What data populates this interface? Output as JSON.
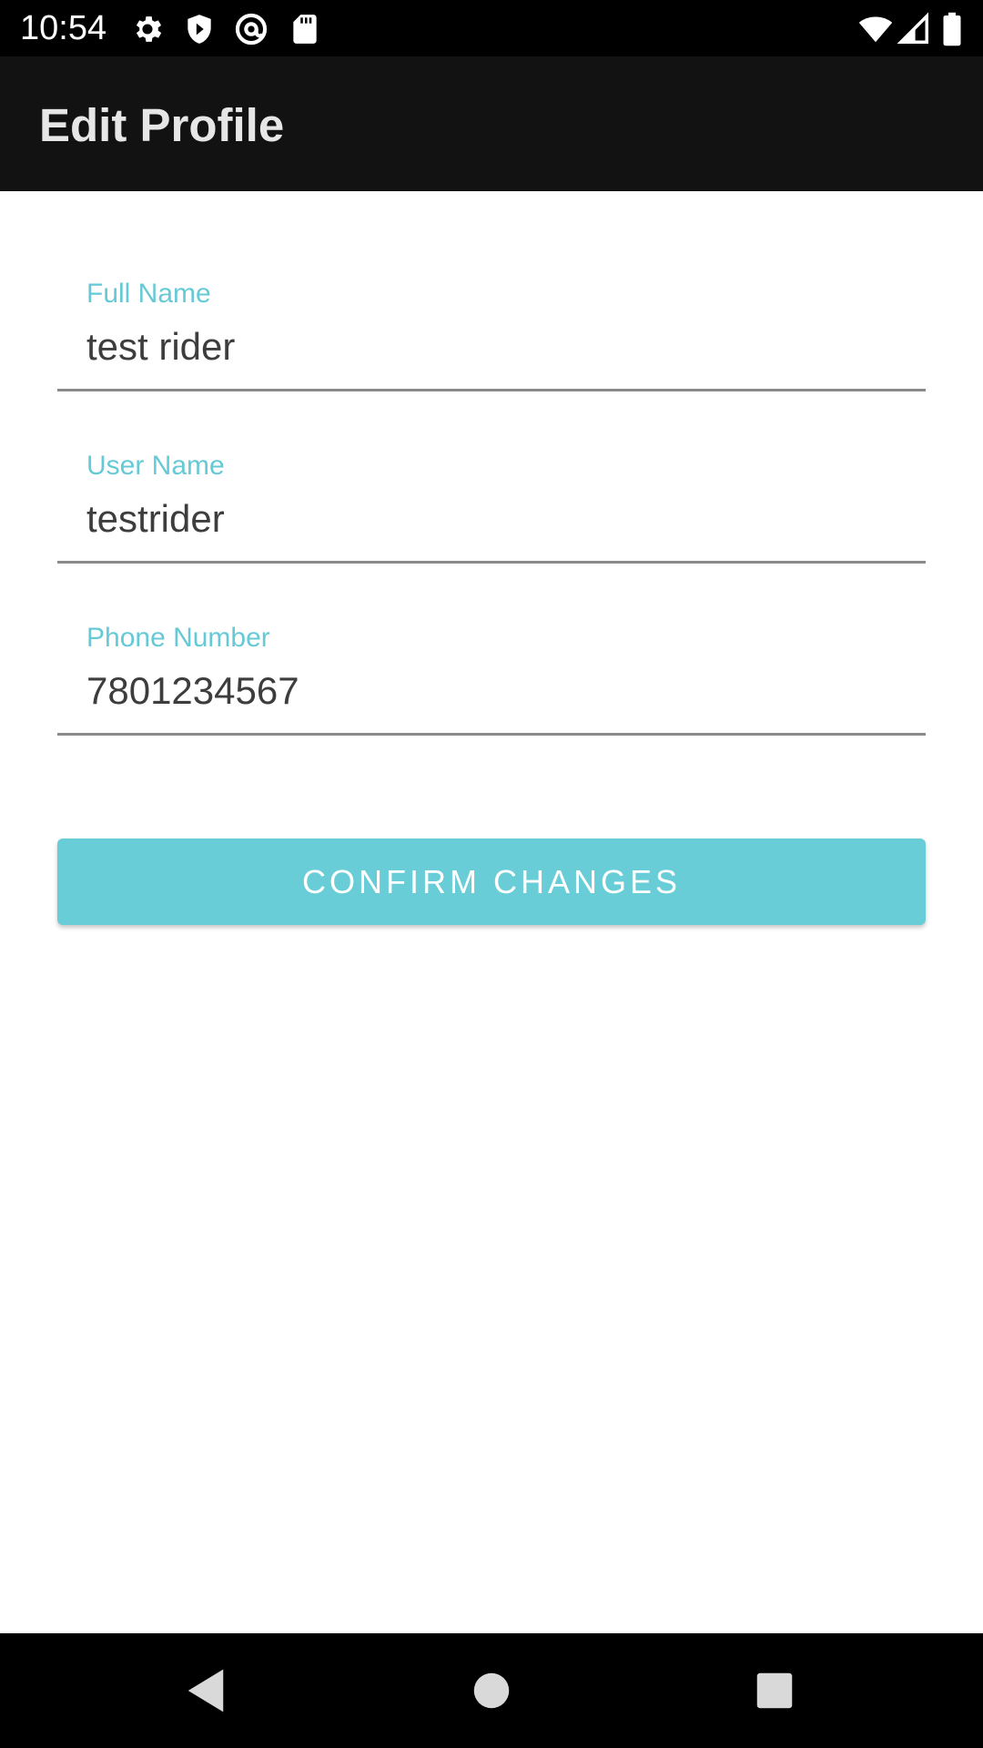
{
  "status_bar": {
    "time": "10:54",
    "icons": [
      "settings-icon",
      "shield-icon",
      "at-icon",
      "sd-card-icon",
      "wifi-icon",
      "signal-icon",
      "battery-icon"
    ]
  },
  "app_bar": {
    "title": "Edit Profile"
  },
  "form": {
    "fields": [
      {
        "label": "Full Name",
        "value": "test rider"
      },
      {
        "label": "User Name",
        "value": "testrider"
      },
      {
        "label": "Phone Number",
        "value": "7801234567"
      }
    ],
    "confirm_label": "CONFIRM CHANGES"
  },
  "nav_bar": {
    "buttons": [
      "back-icon",
      "home-icon",
      "recents-icon"
    ]
  },
  "colors": {
    "accent": "#66c9d6",
    "button": "#69cdd7",
    "app_bar": "#121212",
    "status_bar": "#000000"
  }
}
